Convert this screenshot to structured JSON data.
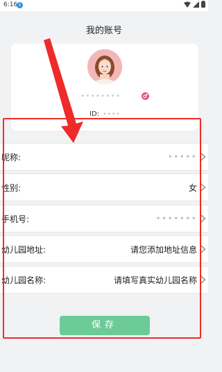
{
  "statusbar": {
    "time": "6:16",
    "badge": "S"
  },
  "page": {
    "title": "我的账号"
  },
  "profile": {
    "username": "∙∙∙∙∙∙∙∙",
    "id_label": "ID:",
    "id_value": "∙∙∙∙"
  },
  "rows": [
    {
      "label": "昵称:",
      "value": "∙∙∙∙∙"
    },
    {
      "label": "性别:",
      "value": "女"
    },
    {
      "label": "手机号:",
      "value": "∙∙∙∙∙∙∙"
    },
    {
      "label": "幼儿园地址:",
      "value": "请您添加地址信息"
    },
    {
      "label": "幼儿园名称:",
      "value": "请填写真实幼儿园名称"
    }
  ],
  "save_label": "保存",
  "colors": {
    "accent_green": "#6ccb98",
    "annotation_red": "#ee2a2a",
    "gender_icon": "#e8508f"
  },
  "icons": [
    "wifi-icon",
    "signal-icon",
    "battery-icon",
    "female-icon",
    "chevron-right-icon"
  ]
}
